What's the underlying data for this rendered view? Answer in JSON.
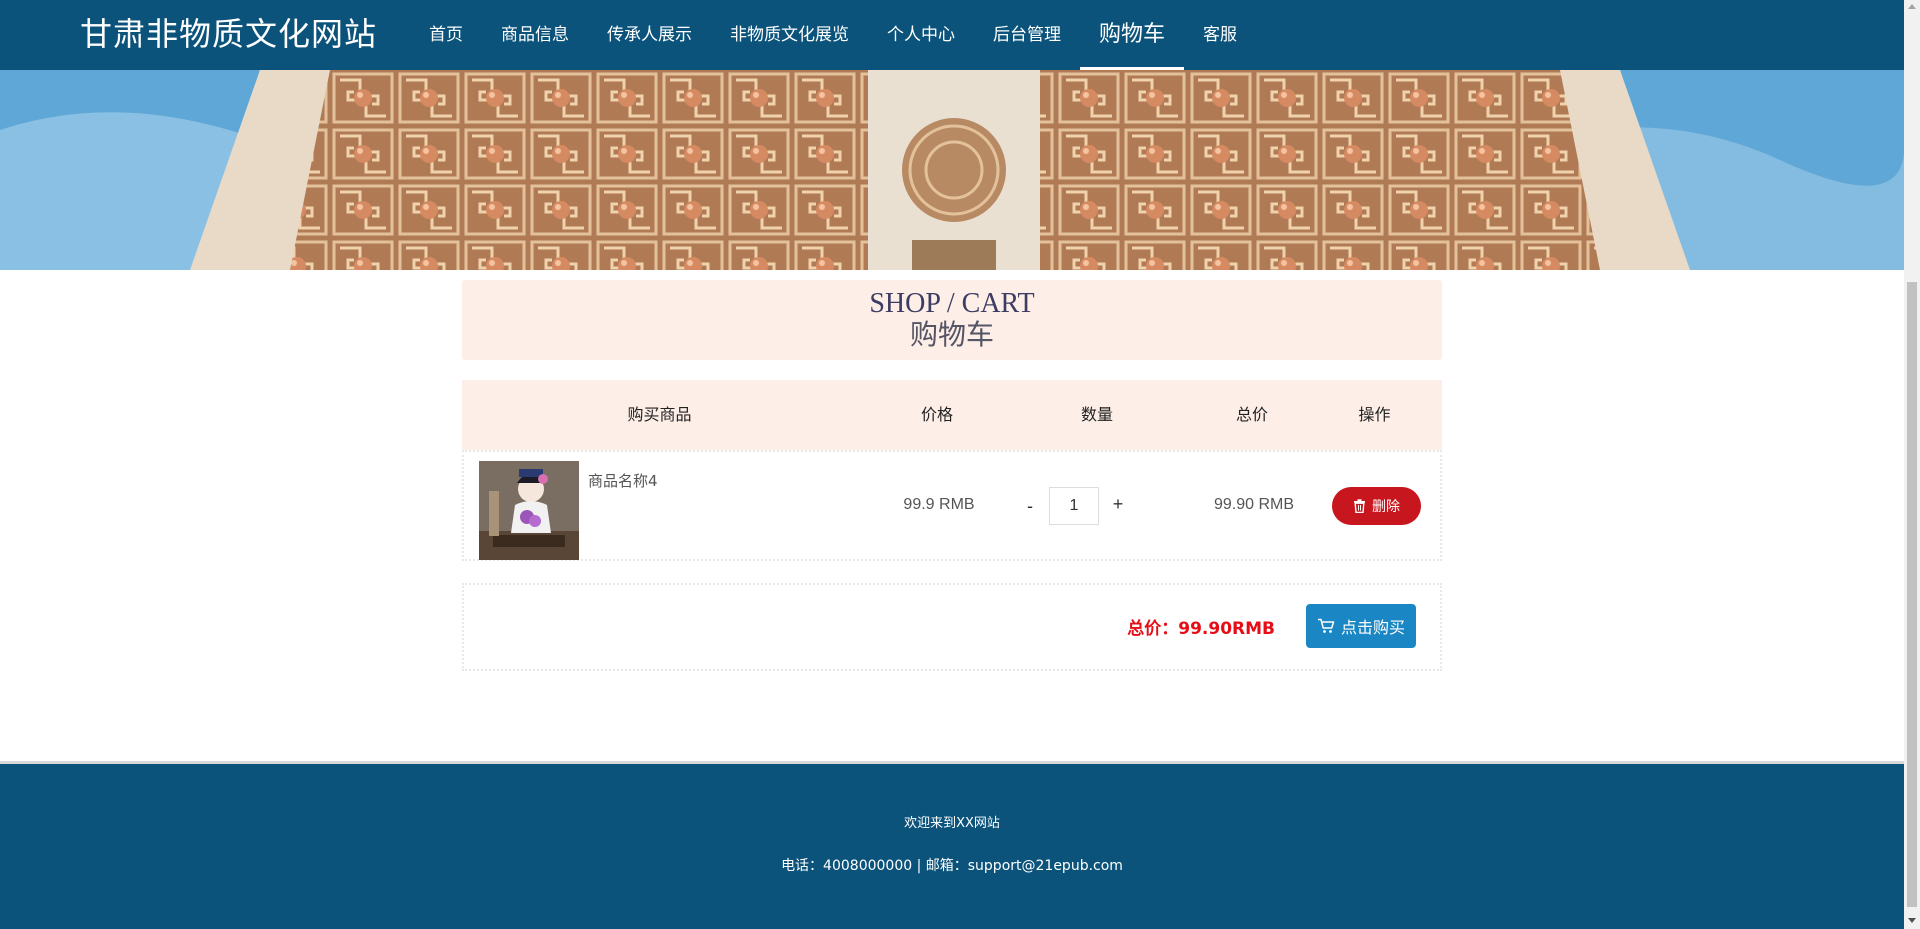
{
  "header": {
    "site_title": "甘肃非物质文化网站",
    "nav": [
      {
        "label": "首页"
      },
      {
        "label": "商品信息"
      },
      {
        "label": "传承人展示"
      },
      {
        "label": "非物质文化展览"
      },
      {
        "label": "个人中心"
      },
      {
        "label": "后台管理"
      },
      {
        "label": "购物车",
        "active": true
      },
      {
        "label": "客服"
      }
    ]
  },
  "banner": {
    "slide_count": 3,
    "active_slide": 1
  },
  "cart": {
    "title_en": "SHOP / CART",
    "title_cn": "购物车",
    "columns": [
      "购买商品",
      "价格",
      "数量",
      "总价",
      "操作"
    ],
    "items": [
      {
        "name": "商品名称4",
        "price": "99.9 RMB",
        "qty_minus": "-",
        "quantity": "1",
        "qty_plus": "+",
        "subtotal": "99.90 RMB",
        "delete_label": "删除"
      }
    ],
    "total_label": "总价：99.90RMB",
    "buy_label": "点击购买"
  },
  "footer": {
    "welcome": "欢迎来到XX网站",
    "contact": "电话：4008000000 | 邮箱：support@21epub.com"
  },
  "colors": {
    "header_bg": "#0b537b",
    "panel_bg": "#fdeee7",
    "delete_btn": "#c8161e",
    "buy_btn": "#1a86c3",
    "total_text": "#e60d16"
  },
  "icons": {
    "delete": "trash-icon",
    "buy": "cart-icon"
  }
}
